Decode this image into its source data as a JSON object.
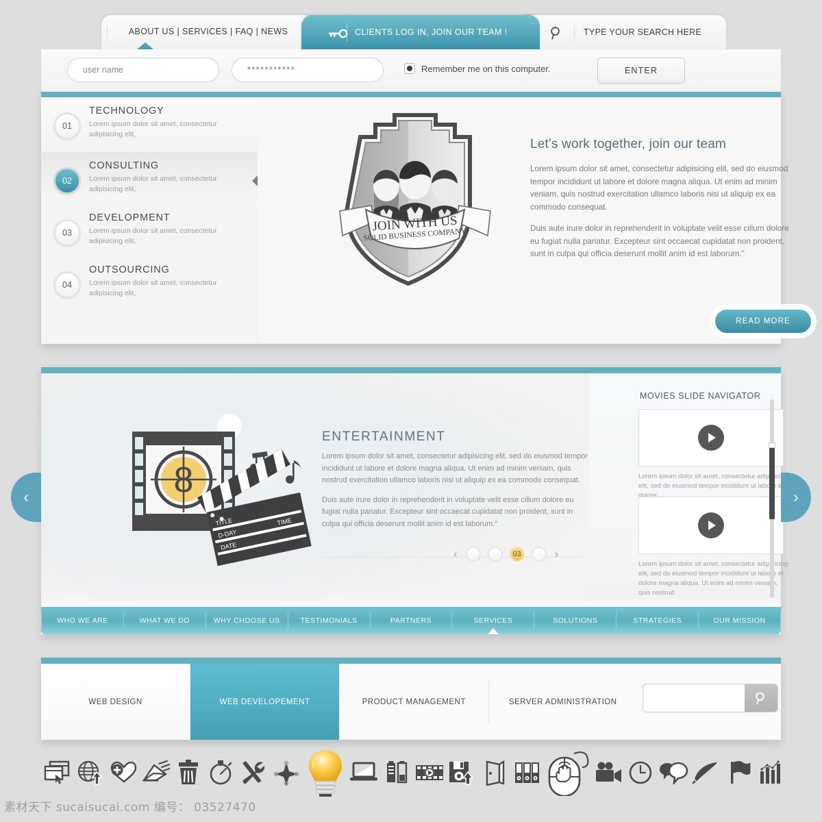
{
  "topbar": {
    "menu_text": "ABOUT US  |  SERVICES  |  FAQ  |  NEWS",
    "clients_label": "CLIENTS LOG IN, JOIN OUR TEAM !",
    "search_label": "TYPE YOUR SEARCH HERE"
  },
  "login": {
    "username_value": "user name",
    "password_value": "***********",
    "remember_label": "Remember me on this computer.",
    "enter_label": "ENTER"
  },
  "hero": {
    "items": [
      {
        "num": "01",
        "title": "TECHNOLOGY",
        "desc": "Lorem ipsum dolor sit amet, consectetur adipisicing elit,"
      },
      {
        "num": "02",
        "title": "CONSULTING",
        "desc": "Lorem ipsum dolor sit amet, consectetur adipisicing elit,"
      },
      {
        "num": "03",
        "title": "DEVELOPMENT",
        "desc": "Lorem ipsum dolor sit amet, consectetur adipisicing elit,"
      },
      {
        "num": "04",
        "title": "OUTSOURCING",
        "desc": "Lorem ipsum dolor sit amet, consectetur adipisicing elit,"
      }
    ],
    "active_index": 1,
    "badge": {
      "line1": "JOIN WITH US",
      "line2": "SOLID BUSINESS COMPANY"
    },
    "heading": "Let's work together, join our team",
    "para1": "Lorem ipsum dolor sit amet, consectetur adipisicing elit, sed do eiusmod tempor incididunt ut labore et dolore magna aliqua. Ut enim ad minim veniam, quis nostrud exercitation ullamco laboris nisi ut aliquip ex ea commodo consequat.",
    "para2": "Duis aute irure dolor in reprehenderit in voluptate velit esse cillum dolore eu fugiat nulla pariatur. Excepteur sint occaecat cupidatat non proident, sunt in culpa qui officia deserunt mollit anim id est laborum.\"",
    "read_more_label": "READ MORE"
  },
  "slider": {
    "heading": "ENTERTAINMENT",
    "para1": "Lorem ipsum dolor sit amet, consectetur adipisicing elit, sed do eiusmod tempor incididunt ut labore et dolore magna aliqua. Ut enim ad minim veniam, quis nostrud exercitation ullamco laboris nisi ut aliquip ex ea commodo consequat.",
    "para2": "Duis aute irure dolor in reprehenderit in voluptate velit esse cillum dolore eu fugiat nulla pariatur. Excepteur sint occaecat cupidatat non proident, sunt in culpa qui officia deserunt mollit anim id est laborum.\"",
    "pager": {
      "prev": "‹",
      "next": "›",
      "active_label": "03",
      "dot_count": 4,
      "active_index": 2
    },
    "clapper": {
      "title": "TITLE",
      "dday": "D-DAY",
      "date": "DATE",
      "time": "TIME",
      "countdown": "8"
    },
    "side_prev": "‹",
    "side_next": "›",
    "movies": {
      "title": "MOVIES SLIDE NAVIGATOR",
      "items": [
        {
          "caption": "Lorem ipsum dolor sit amet, consectetur adipisicing elit, sed do eiusmod tempor incididunt ut labore et dolore"
        },
        {
          "caption": "Lorem ipsum dolor sit amet, consectetur adipisicing elit, sed do eiusmod tempor incididunt ut labore et dolore magna aliqua. Ut enim ad minim veniam, quis nostrud"
        }
      ]
    }
  },
  "navbar": {
    "items": [
      "WHO WE ARE",
      "WHAT WE DO",
      "WHY CHOOSE US",
      "TESTIMONIALS",
      "PARTNERS",
      "SERVICES",
      "SOLUTIONS",
      "STRATEGIES",
      "OUR MISSION"
    ],
    "active_index": 5
  },
  "bottom": {
    "tabs": [
      {
        "label": "WEB DESIGN",
        "active": false
      },
      {
        "label": "WEB DEVELOPEMENT",
        "active": true
      },
      {
        "label": "PRODUCT MANAGEMENT",
        "active": false
      },
      {
        "label": "SERVER ADMINISTRATION",
        "active": false
      }
    ],
    "search_value": ""
  },
  "icons": [
    "browser-window-icon",
    "globe-upload-icon",
    "heart-plus-icon",
    "envelope-send-icon",
    "trash-icon",
    "stopwatch-icon",
    "tools-icon",
    "compass-icon",
    "lightbulb-icon",
    "laptop-icon",
    "battery-icon",
    "film-strip-icon",
    "floppy-save-icon",
    "door-exit-icon",
    "binders-icon",
    "mouse-click-icon",
    "movie-camera-icon",
    "clock-icon",
    "speech-bubbles-icon",
    "feather-pen-icon",
    "flag-icon",
    "bar-chart-icon"
  ],
  "watermark": "素材天下 sucaisucai.com  编号： 03527470",
  "colors": {
    "teal": "#5BB0C0",
    "teal_dark": "#3D90A6",
    "gold": "#F0C45C",
    "text_dark": "#4A4A4A"
  }
}
